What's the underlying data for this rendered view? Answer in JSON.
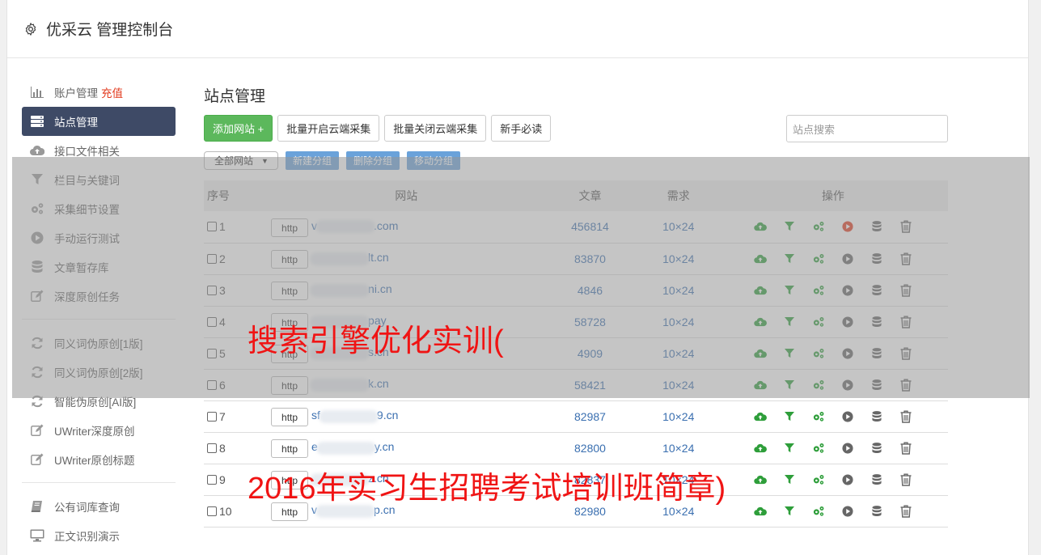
{
  "header": {
    "title": "优采云 管理控制台",
    "icon": "gear-icon"
  },
  "sidebar": {
    "group1": [
      {
        "label": "账户管理",
        "extra": "充值",
        "icon": "bar-chart-icon"
      },
      {
        "label": "站点管理",
        "icon": "server-icon",
        "active": true
      },
      {
        "label": "接口文件相关",
        "icon": "cloud-upload-icon"
      },
      {
        "label": "栏目与关键词",
        "icon": "filter-icon"
      },
      {
        "label": "采集细节设置",
        "icon": "gears-icon"
      },
      {
        "label": "手动运行测试",
        "icon": "play-circle-icon"
      },
      {
        "label": "文章暂存库",
        "icon": "database-icon"
      },
      {
        "label": "深度原创任务",
        "icon": "edit-icon"
      }
    ],
    "group2": [
      {
        "label": "同义词伪原创[1版]",
        "icon": "refresh-icon"
      },
      {
        "label": "同义词伪原创[2版]",
        "icon": "refresh-icon"
      },
      {
        "label": "智能伪原创[AI版]",
        "icon": "refresh-icon"
      },
      {
        "label": "UWriter深度原创",
        "icon": "edit-icon"
      },
      {
        "label": "UWriter原创标题",
        "icon": "edit-icon"
      }
    ],
    "group3": [
      {
        "label": "公有词库查询",
        "icon": "book-icon"
      },
      {
        "label": "正文识别演示",
        "icon": "monitor-icon"
      }
    ]
  },
  "main": {
    "title": "站点管理",
    "buttons": {
      "add": "添加网站 +",
      "batch_open": "批量开启云端采集",
      "batch_close": "批量关闭云端采集",
      "guide": "新手必读"
    },
    "search_placeholder": "站点搜索",
    "group_select": "全部网站",
    "group_buttons": {
      "new": "新建分组",
      "delete": "删除分组",
      "move": "移动分组"
    },
    "table": {
      "headers": {
        "idx": "序号",
        "site": "网站",
        "articles": "文章",
        "demand": "需求",
        "ops": "操作"
      },
      "rows": [
        {
          "idx": "1",
          "proto": "http",
          "prefix": "v",
          "suffix": ".com",
          "articles": "456814",
          "demand": "10×24",
          "play_active": true
        },
        {
          "idx": "2",
          "proto": "http",
          "prefix": "",
          "suffix": "lt.cn",
          "articles": "83870",
          "demand": "10×24"
        },
        {
          "idx": "3",
          "proto": "http",
          "prefix": "",
          "suffix": "ni.cn",
          "articles": "4846",
          "demand": "10×24"
        },
        {
          "idx": "4",
          "proto": "http",
          "prefix": "",
          "suffix": "pay",
          "articles": "58728",
          "demand": "10×24"
        },
        {
          "idx": "5",
          "proto": "http",
          "prefix": "",
          "suffix": "s.cn",
          "articles": "4909",
          "demand": "10×24"
        },
        {
          "idx": "6",
          "proto": "http",
          "prefix": "",
          "suffix": "k.cn",
          "articles": "58421",
          "demand": "10×24"
        },
        {
          "idx": "7",
          "proto": "http",
          "prefix": "sf",
          "suffix": "9.cn",
          "articles": "82987",
          "demand": "10×24"
        },
        {
          "idx": "8",
          "proto": "http",
          "prefix": "e",
          "suffix": "y.cn",
          "articles": "82800",
          "demand": "10×24"
        },
        {
          "idx": "9",
          "proto": "http",
          "prefix": "",
          "suffix": "z.cn",
          "articles": "82837",
          "demand": "10×24"
        },
        {
          "idx": "10",
          "proto": "http",
          "prefix": "v",
          "suffix": "p.cn",
          "articles": "82980",
          "demand": "10×24"
        }
      ]
    }
  },
  "watermark": {
    "line1": "搜索引擎优化实训(",
    "line2": "2016年实习生招聘考试培训班简章)"
  },
  "colors": {
    "accent_green": "#5cb85c",
    "sidebar_active": "#3e4a66",
    "link_blue": "#3a6fb0",
    "watermark_red": "#f01414",
    "op_green": "#2e9e3a",
    "op_red": "#e23a1e"
  }
}
